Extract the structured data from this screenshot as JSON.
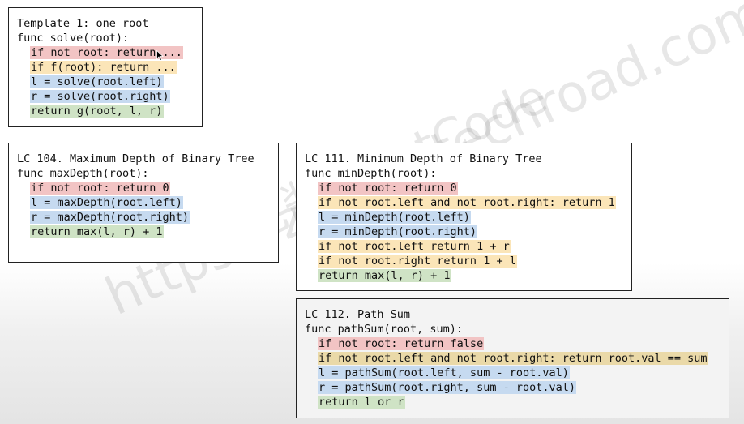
{
  "watermark": {
    "url": "https://zxi.mytechroad.com/blog/",
    "site": "花花酱 LeetCode"
  },
  "boxes": {
    "template": {
      "lines": [
        {
          "text": "Template 1: one root",
          "indent": 0,
          "hl": ""
        },
        {
          "text": "func solve(root):",
          "indent": 0,
          "hl": ""
        },
        {
          "text": "if not root: return ...",
          "indent": 1,
          "hl": "red"
        },
        {
          "text": "if f(root): return ...",
          "indent": 1,
          "hl": "yellow"
        },
        {
          "text": "l = solve(root.left)",
          "indent": 1,
          "hl": "blue"
        },
        {
          "text": "r = solve(root.right)",
          "indent": 1,
          "hl": "blue"
        },
        {
          "text": "return g(root, l, r)",
          "indent": 1,
          "hl": "green"
        }
      ]
    },
    "lc104": {
      "lines": [
        {
          "text": "LC 104. Maximum Depth of Binary Tree",
          "indent": 0,
          "hl": ""
        },
        {
          "text": "func maxDepth(root):",
          "indent": 0,
          "hl": ""
        },
        {
          "text": "if not root: return 0",
          "indent": 1,
          "hl": "red"
        },
        {
          "text": "l = maxDepth(root.left)",
          "indent": 1,
          "hl": "blue"
        },
        {
          "text": "r = maxDepth(root.right)",
          "indent": 1,
          "hl": "blue"
        },
        {
          "text": "return max(l, r) + 1",
          "indent": 1,
          "hl": "green"
        }
      ]
    },
    "lc111": {
      "lines": [
        {
          "text": "LC 111. Minimum Depth of Binary Tree",
          "indent": 0,
          "hl": ""
        },
        {
          "text": "func minDepth(root):",
          "indent": 0,
          "hl": ""
        },
        {
          "text": "if not root: return 0",
          "indent": 1,
          "hl": "red"
        },
        {
          "text": "if not root.left and not root.right: return 1",
          "indent": 1,
          "hl": "yellow"
        },
        {
          "text": "l = minDepth(root.left)",
          "indent": 1,
          "hl": "blue"
        },
        {
          "text": "r = minDepth(root.right)",
          "indent": 1,
          "hl": "blue"
        },
        {
          "text": "if not root.left return 1 + r",
          "indent": 1,
          "hl": "yellow"
        },
        {
          "text": "if not root.right return 1 + l",
          "indent": 1,
          "hl": "yellow"
        },
        {
          "text": "return max(l, r) + 1",
          "indent": 1,
          "hl": "green"
        }
      ]
    },
    "lc112": {
      "lines": [
        {
          "text": "LC 112. Path Sum",
          "indent": 0,
          "hl": ""
        },
        {
          "text": "func pathSum(root, sum):",
          "indent": 0,
          "hl": ""
        },
        {
          "text": "if not root: return false",
          "indent": 1,
          "hl": "red"
        },
        {
          "text": "if not root.left and not root.right: return root.val == sum",
          "indent": 1,
          "hl": "tan"
        },
        {
          "text": "l = pathSum(root.left, sum - root.val)",
          "indent": 1,
          "hl": "blue"
        },
        {
          "text": "r = pathSum(root.right, sum - root.val)",
          "indent": 1,
          "hl": "blue"
        },
        {
          "text": "return l or r",
          "indent": 1,
          "hl": "green"
        }
      ]
    }
  },
  "colors": {
    "red": "#f2c4c4",
    "yellow": "#fbe5b8",
    "blue": "#c6daf0",
    "green": "#cfe3c5",
    "tan": "#ead9a8"
  }
}
